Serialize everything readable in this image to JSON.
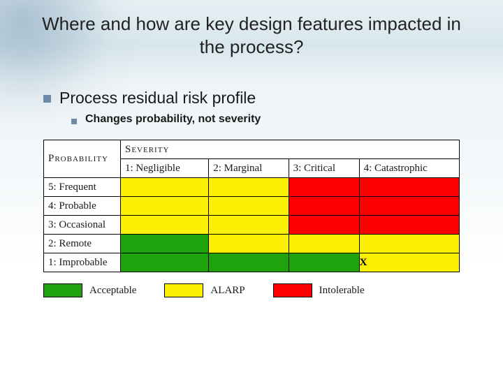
{
  "title": "Where and how are key design features impacted in the process?",
  "bullets": {
    "l1": "Process residual risk profile",
    "l2": "Changes probability, not severity"
  },
  "matrix": {
    "prob_header": "Probability",
    "sev_header": "Severity",
    "sev_cols": [
      "1: Negligible",
      "2: Marginal",
      "3: Critical",
      "4: Catastrophic"
    ],
    "prob_rows": [
      "5: Frequent",
      "4: Probable",
      "3: Occasional",
      "2: Remote",
      "1: Improbable"
    ],
    "cells": [
      [
        "yellow",
        "yellow",
        "red",
        "red"
      ],
      [
        "yellow",
        "yellow",
        "red",
        "red"
      ],
      [
        "yellow",
        "yellow",
        "red",
        "red"
      ],
      [
        "green",
        "yellow",
        "yellow",
        "yellow"
      ],
      [
        "green",
        "green",
        "green",
        "yellow"
      ]
    ],
    "mark": {
      "row": 4,
      "col": 3,
      "label": "X"
    }
  },
  "legend": [
    {
      "color": "green",
      "label": "Acceptable"
    },
    {
      "color": "yellow",
      "label": "ALARP"
    },
    {
      "color": "red",
      "label": "Intolerable"
    }
  ]
}
